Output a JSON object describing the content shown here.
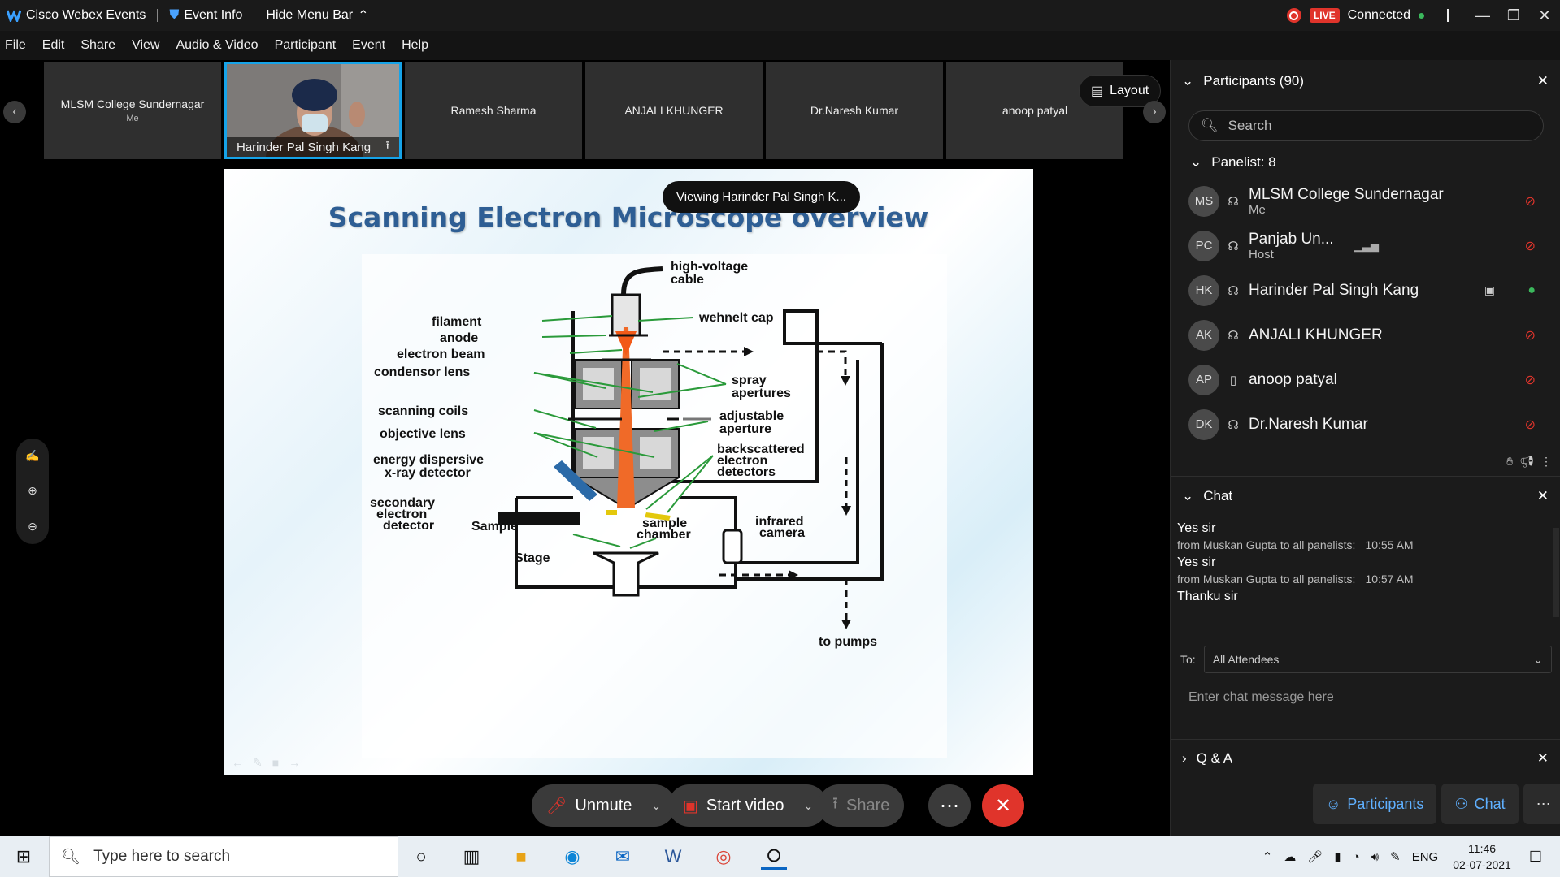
{
  "titlebar": {
    "app_name": "Cisco Webex Events",
    "event_info": "Event Info",
    "hide_menu": "Hide Menu Bar",
    "live": "LIVE",
    "status": "Connected"
  },
  "menu": [
    "File",
    "Edit",
    "Share",
    "View",
    "Audio & Video",
    "Participant",
    "Event",
    "Help"
  ],
  "video_strip": {
    "tiles": [
      {
        "name": "MLSM College Sundernagar",
        "sub": "Me"
      },
      {
        "name": "Harinder Pal Singh Kang",
        "sub": ""
      },
      {
        "name": "Ramesh Sharma",
        "sub": ""
      },
      {
        "name": "ANJALI KHUNGER",
        "sub": ""
      },
      {
        "name": "Dr.Naresh Kumar",
        "sub": ""
      },
      {
        "name": "anoop patyal",
        "sub": ""
      }
    ],
    "layout_label": "Layout"
  },
  "share": {
    "viewing_toast": "Viewing Harinder Pal Singh K...",
    "slide_title": "Scanning Electron Microscope overview",
    "labels": {
      "hv_cable": [
        "high-voltage",
        "cable"
      ],
      "filament": "filament",
      "anode": "anode",
      "electron_beam": "electron beam",
      "condensor_lens": "condensor lens",
      "scanning_coils": "scanning coils",
      "objective_lens": "objective lens",
      "edx": [
        "energy dispersive",
        "x-ray detector"
      ],
      "secondary": [
        "secondary",
        "electron",
        "detector"
      ],
      "sample": "Sample",
      "stage": "Stage",
      "wehnelt": "wehnelt cap",
      "spray": [
        "spray",
        "apertures"
      ],
      "adjustable": [
        "adjustable",
        "aperture"
      ],
      "backscattered": [
        "backscattered",
        "electron",
        "detectors"
      ],
      "sample_chamber": [
        "sample",
        "chamber"
      ],
      "infrared": [
        "infrared",
        "camera"
      ],
      "pumps": "to pumps"
    }
  },
  "controls": {
    "unmute": "Unmute",
    "start_video": "Start video",
    "share": "Share"
  },
  "participants": {
    "header": "Participants (90)",
    "search_placeholder": "Search",
    "panelist_header": "Panelist: 8",
    "list": [
      {
        "initials": "MS",
        "name": "MLSM College Sundernagar",
        "role": "Me",
        "mic": "muted"
      },
      {
        "initials": "PC",
        "name": "Panjab Un...",
        "role": "Host",
        "mic": "muted"
      },
      {
        "initials": "HK",
        "name": "Harinder Pal Singh Kang",
        "role": "",
        "mic": "active"
      },
      {
        "initials": "AK",
        "name": "ANJALI KHUNGER",
        "role": "",
        "mic": "muted"
      },
      {
        "initials": "AP",
        "name": "anoop patyal",
        "role": "",
        "mic": "muted"
      },
      {
        "initials": "DK",
        "name": "Dr.Naresh Kumar",
        "role": "",
        "mic": "muted"
      }
    ]
  },
  "chat": {
    "header": "Chat",
    "messages": [
      {
        "text": "Yes sir",
        "meta": "from Muskan Gupta to all panelists:",
        "time": "10:55 AM"
      },
      {
        "text": "Yes sir",
        "meta": "from Muskan Gupta to all panelists:",
        "time": "10:57 AM"
      },
      {
        "text": "Thanku sir",
        "meta": "",
        "time": ""
      }
    ],
    "to_label": "To:",
    "to_value": "All Attendees",
    "input_placeholder": "Enter chat message here"
  },
  "qa": {
    "header": "Q & A"
  },
  "panel_tabs": {
    "participants": "Participants",
    "chat": "Chat"
  },
  "taskbar": {
    "search_placeholder": "Type here to search",
    "lang": "ENG",
    "time": "11:46",
    "date": "02-07-2021"
  },
  "colors": {
    "accent": "#16a3e8",
    "leave": "#e0342b",
    "link": "#5fb0ff",
    "mic_muted": "#e0342b",
    "mic_active": "#3bb85c"
  }
}
